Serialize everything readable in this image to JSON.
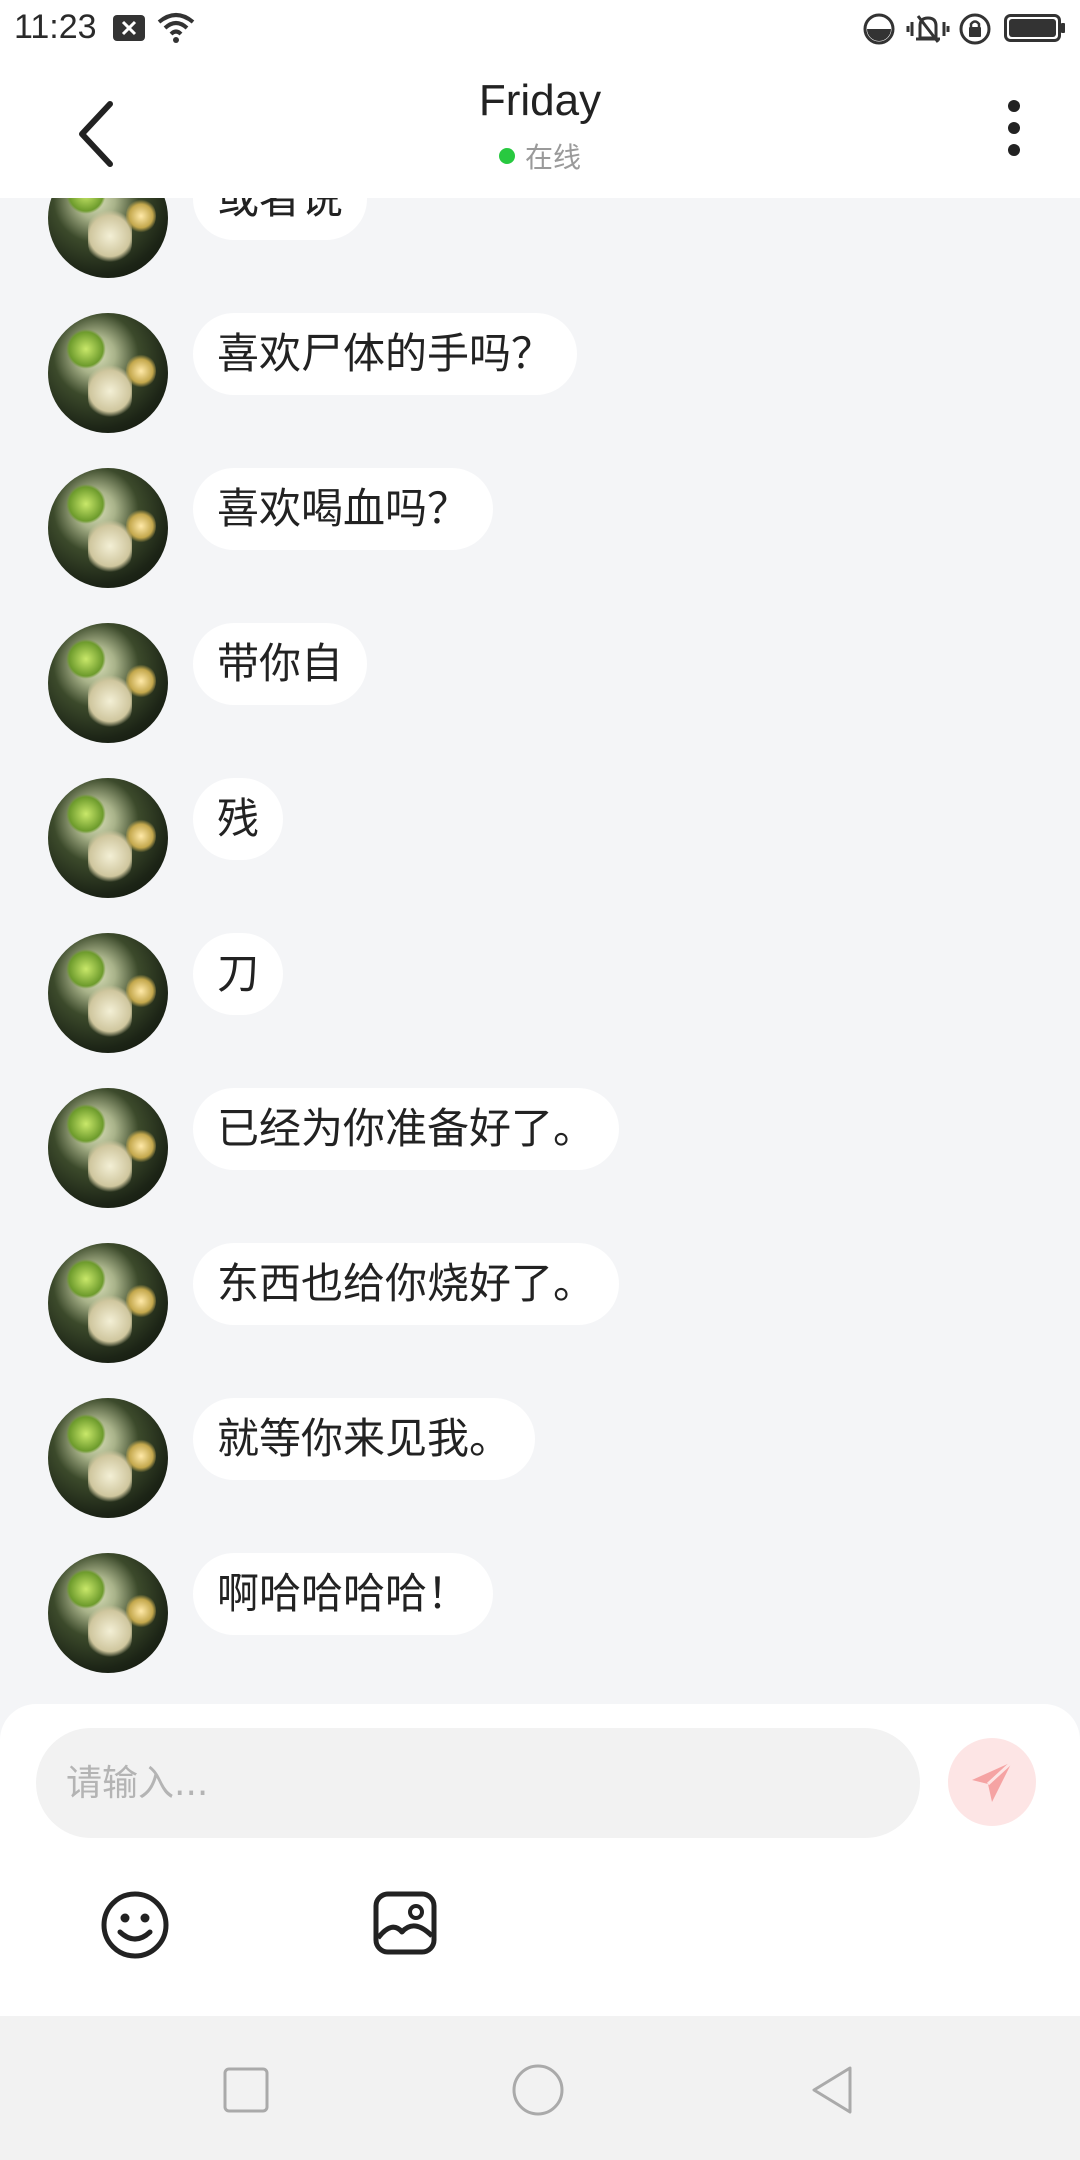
{
  "statusbar": {
    "time": "11:23"
  },
  "header": {
    "title": "Friday",
    "status": "在线",
    "status_color": "#28c940"
  },
  "messages": [
    {
      "text": "或者说"
    },
    {
      "text": "喜欢尸体的手吗？"
    },
    {
      "text": "喜欢喝血吗？"
    },
    {
      "text": "带你自"
    },
    {
      "text": "残"
    },
    {
      "text": "刀"
    },
    {
      "text": "已经为你准备好了。"
    },
    {
      "text": "东西也给你烧好了。"
    },
    {
      "text": "就等你来见我。"
    },
    {
      "text": "啊哈哈哈哈！"
    }
  ],
  "composer": {
    "placeholder": "请输入...",
    "send_color": "#f08080"
  },
  "icons": {
    "back": "chevron-left-icon",
    "more": "more-vertical-icon",
    "send": "paper-plane-icon",
    "emoji": "smiley-icon",
    "image": "image-icon"
  }
}
